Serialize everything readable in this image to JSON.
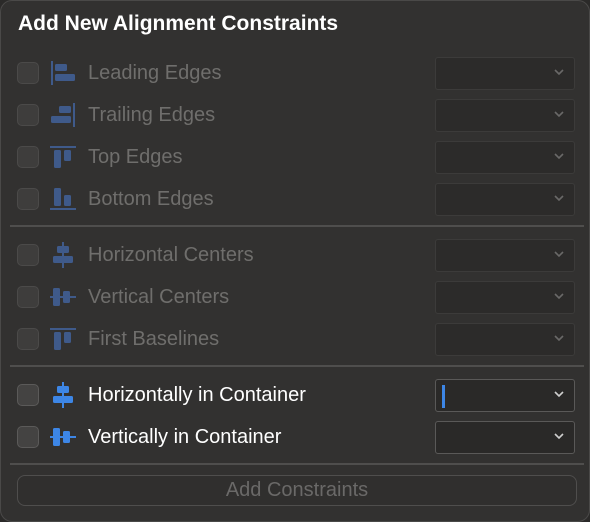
{
  "title": "Add New Alignment Constraints",
  "rows": [
    {
      "label": "Leading Edges",
      "icon": "leading-edges-icon",
      "checked": false,
      "enabled": false
    },
    {
      "label": "Trailing Edges",
      "icon": "trailing-edges-icon",
      "checked": false,
      "enabled": false
    },
    {
      "label": "Top Edges",
      "icon": "top-edges-icon",
      "checked": false,
      "enabled": false
    },
    {
      "label": "Bottom Edges",
      "icon": "bottom-edges-icon",
      "checked": false,
      "enabled": false
    },
    {
      "label": "Horizontal Centers",
      "icon": "horizontal-centers-icon",
      "checked": false,
      "enabled": false
    },
    {
      "label": "Vertical Centers",
      "icon": "vertical-centers-icon",
      "checked": false,
      "enabled": false
    },
    {
      "label": "First Baselines",
      "icon": "first-baselines-icon",
      "checked": false,
      "enabled": false
    },
    {
      "label": "Horizontally in Container",
      "icon": "horizontally-in-container-icon",
      "checked": false,
      "enabled": true
    },
    {
      "label": "Vertically in Container",
      "icon": "vertically-in-container-icon",
      "checked": false,
      "enabled": true
    }
  ],
  "add_button": {
    "label": "Add Constraints",
    "enabled": false
  },
  "colors": {
    "icon_disabled": "#3f5a8a",
    "icon_active": "#3d86e6",
    "focus_caret": "#3d86e6"
  }
}
